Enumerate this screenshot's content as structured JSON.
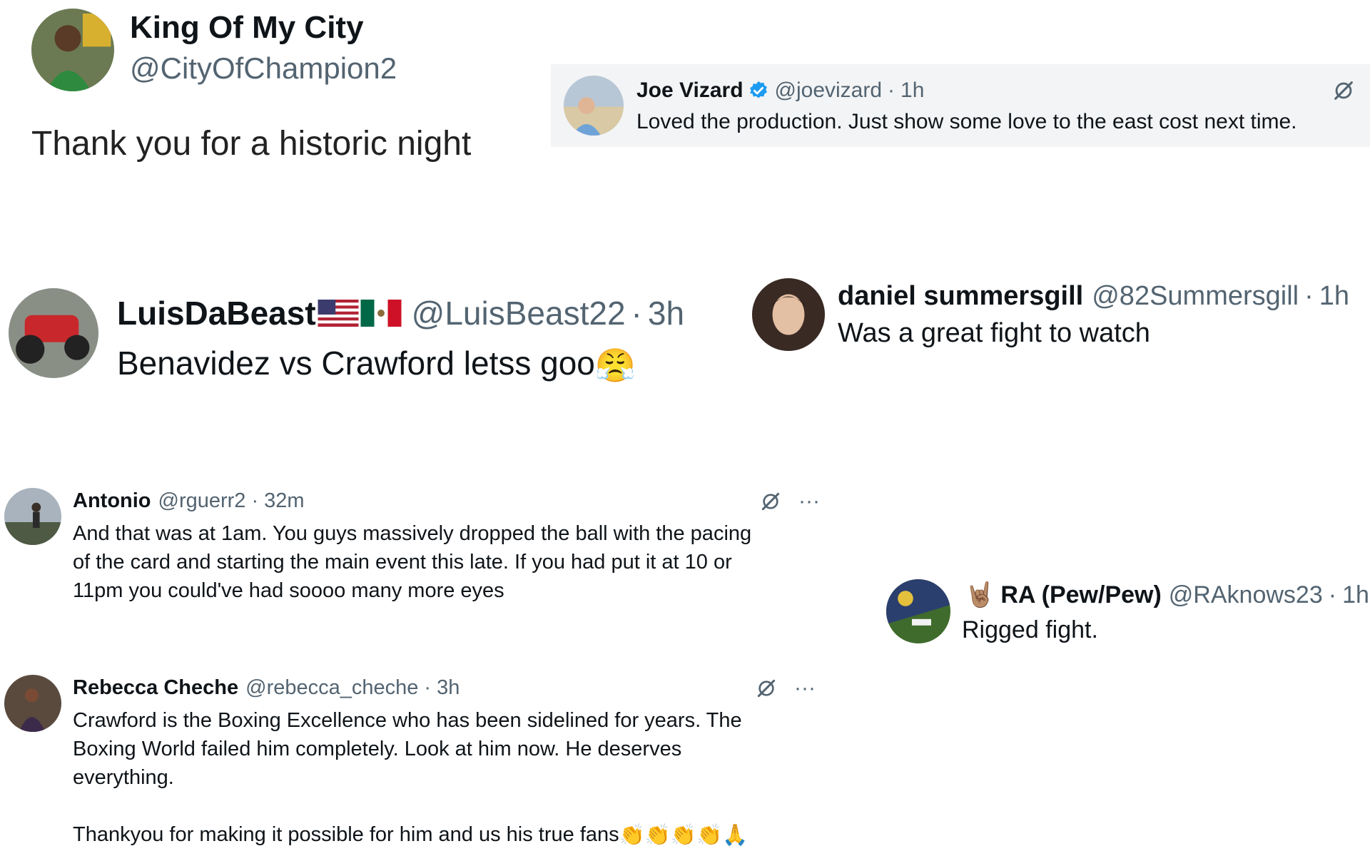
{
  "posts": [
    {
      "name": "King Of My City",
      "handle": "@CityOfChampion2",
      "text": "Thank you for a historic night",
      "avatar_icon": "user-avatar"
    },
    {
      "name": "Joe Vizard",
      "handle": "@joevizard",
      "time": "1h",
      "verified": true,
      "text": "Loved the production. Just show some love to the east cost next time.",
      "icons": [
        "verified-badge-icon",
        "grok-icon"
      ]
    },
    {
      "name": "LuisDaBeast",
      "name_emojis": [
        "us-flag",
        "mexico-flag"
      ],
      "handle": "@LuisBeast22",
      "time": "3h",
      "text": "Benavidez vs Crawford letss goo",
      "text_emoji": "😤"
    },
    {
      "name": "daniel summersgill",
      "handle": "@82Summersgill",
      "time": "1h",
      "text": "Was a great fight to watch"
    },
    {
      "name": "Antonio",
      "handle": "@rguerr2",
      "time": "32m",
      "text": "And that was at 1am. You guys massively dropped the ball with the pacing\nof the card and starting the main event this late. If you had put it at 10 or\n11pm you could've had soooo many more eyes",
      "icons": [
        "grok-icon",
        "more-icon"
      ]
    },
    {
      "name_prefix_emoji": "🤘🏽",
      "name": "RA (Pew/Pew)",
      "handle": "@RAknows23",
      "time": "1h",
      "text": "Rigged fight."
    },
    {
      "name": "Rebecca Cheche",
      "handle": "@rebecca_cheche",
      "time": "3h",
      "text": "Crawford is the Boxing Excellence who has been sidelined for years.  The\nBoxing World failed him completely.  Look at him now.   He deserves\neverything.\n\nThankyou for making it possible for him and us his true fans",
      "text_emoji": "👏👏👏👏🙏",
      "icons": [
        "grok-icon",
        "more-icon"
      ]
    }
  ],
  "separator": "·",
  "more_glyph": "···",
  "colors": {
    "text": "#0f1419",
    "muted": "#536471",
    "verified": "#1d9bf0",
    "quote_bg": "#f3f4f5"
  }
}
